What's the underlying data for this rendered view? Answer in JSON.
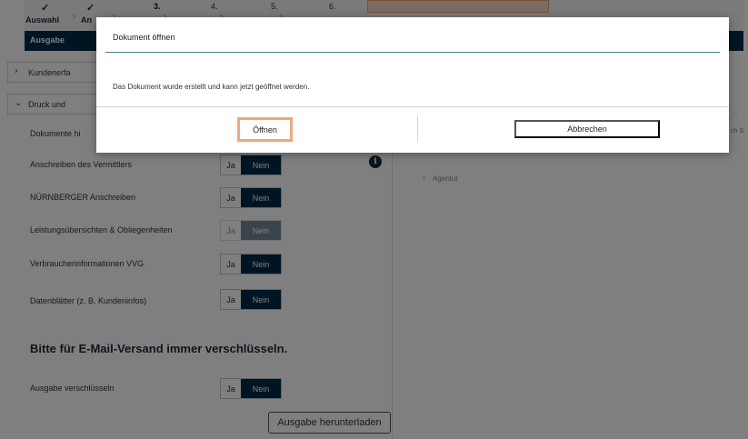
{
  "stepper": {
    "steps": [
      {
        "mark": "✓",
        "label": "Auswahl"
      },
      {
        "mark": "✓",
        "label": "An"
      },
      {
        "number": "3."
      },
      {
        "number": "4."
      },
      {
        "number": "5."
      },
      {
        "number": "6."
      }
    ]
  },
  "section_bar": {
    "label": "Ausgabe"
  },
  "accordions": {
    "kunden": {
      "label": "Kundenerfa",
      "icon": "chevron-right-icon"
    },
    "druck": {
      "label": "Druck und",
      "icon": "chevron-down-icon"
    }
  },
  "rows": [
    {
      "label": "Dokumente hi"
    },
    {
      "label": "Anschreiben des Vermittlers",
      "ja": "Ja",
      "nein": "Nein"
    },
    {
      "label": "NÜRNBERGER Anschreiben",
      "ja": "Ja",
      "nein": "Nein"
    },
    {
      "label": "Leistungsübersichten & Obliegenheiten",
      "ja": "Ja",
      "nein": "Nein"
    },
    {
      "label": "Verbraucherinformationen VVG",
      "ja": "Ja",
      "nein": "Nein"
    },
    {
      "label": "Datenblätter (z. B. Kundeninfos)",
      "ja": "Ja",
      "nein": "Nein"
    }
  ],
  "encrypt": {
    "heading": "Bitte für E-Mail-Versand immer verschlüsseln.",
    "label": "Ausgabe verschlüsseln",
    "ja": "Ja",
    "nein": "Nein"
  },
  "download_button": "Ausgabe herunterladen",
  "right_panel": {
    "agentur": "Agentur",
    "frag_a": "...",
    "frag_b": "ch S"
  },
  "dialog": {
    "title": "Dokument öffnen",
    "message": "Das Dokument wurde erstellt und kann jetzt geöffnet werden.",
    "open_label": "Öffnen",
    "cancel_label": "Abbrechen"
  },
  "colors": {
    "brand_navy": "#002a47",
    "highlight": "#f2a57e"
  }
}
